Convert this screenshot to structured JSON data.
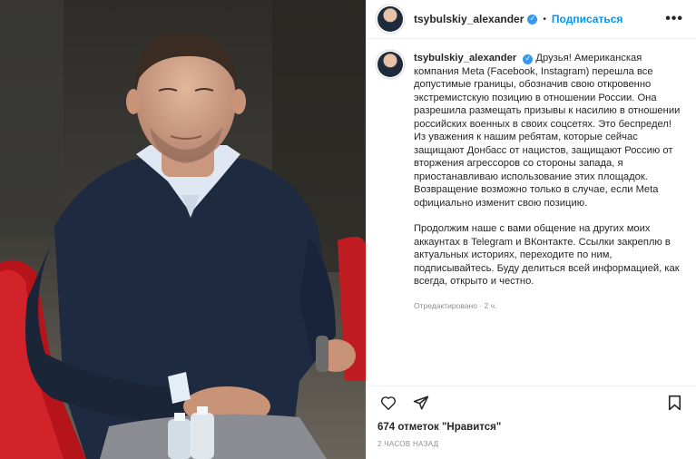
{
  "post": {
    "username": "tsybulskiy_alexander",
    "verified_mark": "✓",
    "separator": "•",
    "follow_label": "Подписаться",
    "more_label": "•••",
    "caption_paragraph_1": "Друзья! Американская компания Meta (Facebook, Instagram) перешла все допустимые границы, обозначив свою откровенно экстремистскую позицию в отношении России. Она разрешила размещать призывы к насилию в отношении российских военных в своих соцсетях. Это беспредел! Из уважения к нашим ребятам, которые сейчас защищают Донбасс от нацистов, защищают Россию от вторжения агрессоров со стороны запада, я приостанавливаю использование этих площадок. Возвращение возможно только в случае, если Meta официально изменит свою позицию.",
    "caption_paragraph_2": "Продолжим наше с вами общение на других моих аккаунтах в Telegram и ВКонтакте. Ссылки закреплю в актуальных историях, переходите по ним, подписывайтесь. Буду делиться всей информацией, как всегда, открыто и честно.",
    "edited_meta": "Отредактировано · 2 ч.",
    "likes_text": "674 отметок \"Нравится\"",
    "timestamp": "2 ЧАСОВ НАЗАД"
  },
  "icons": {
    "like": "heart-icon",
    "share": "paper-plane-icon",
    "save": "bookmark-icon",
    "more": "more-options-icon",
    "verified": "verified-badge-icon"
  },
  "colors": {
    "follow": "#0095f6",
    "verified": "#3897f0",
    "muted": "#8e8e8e",
    "text": "#262626"
  }
}
